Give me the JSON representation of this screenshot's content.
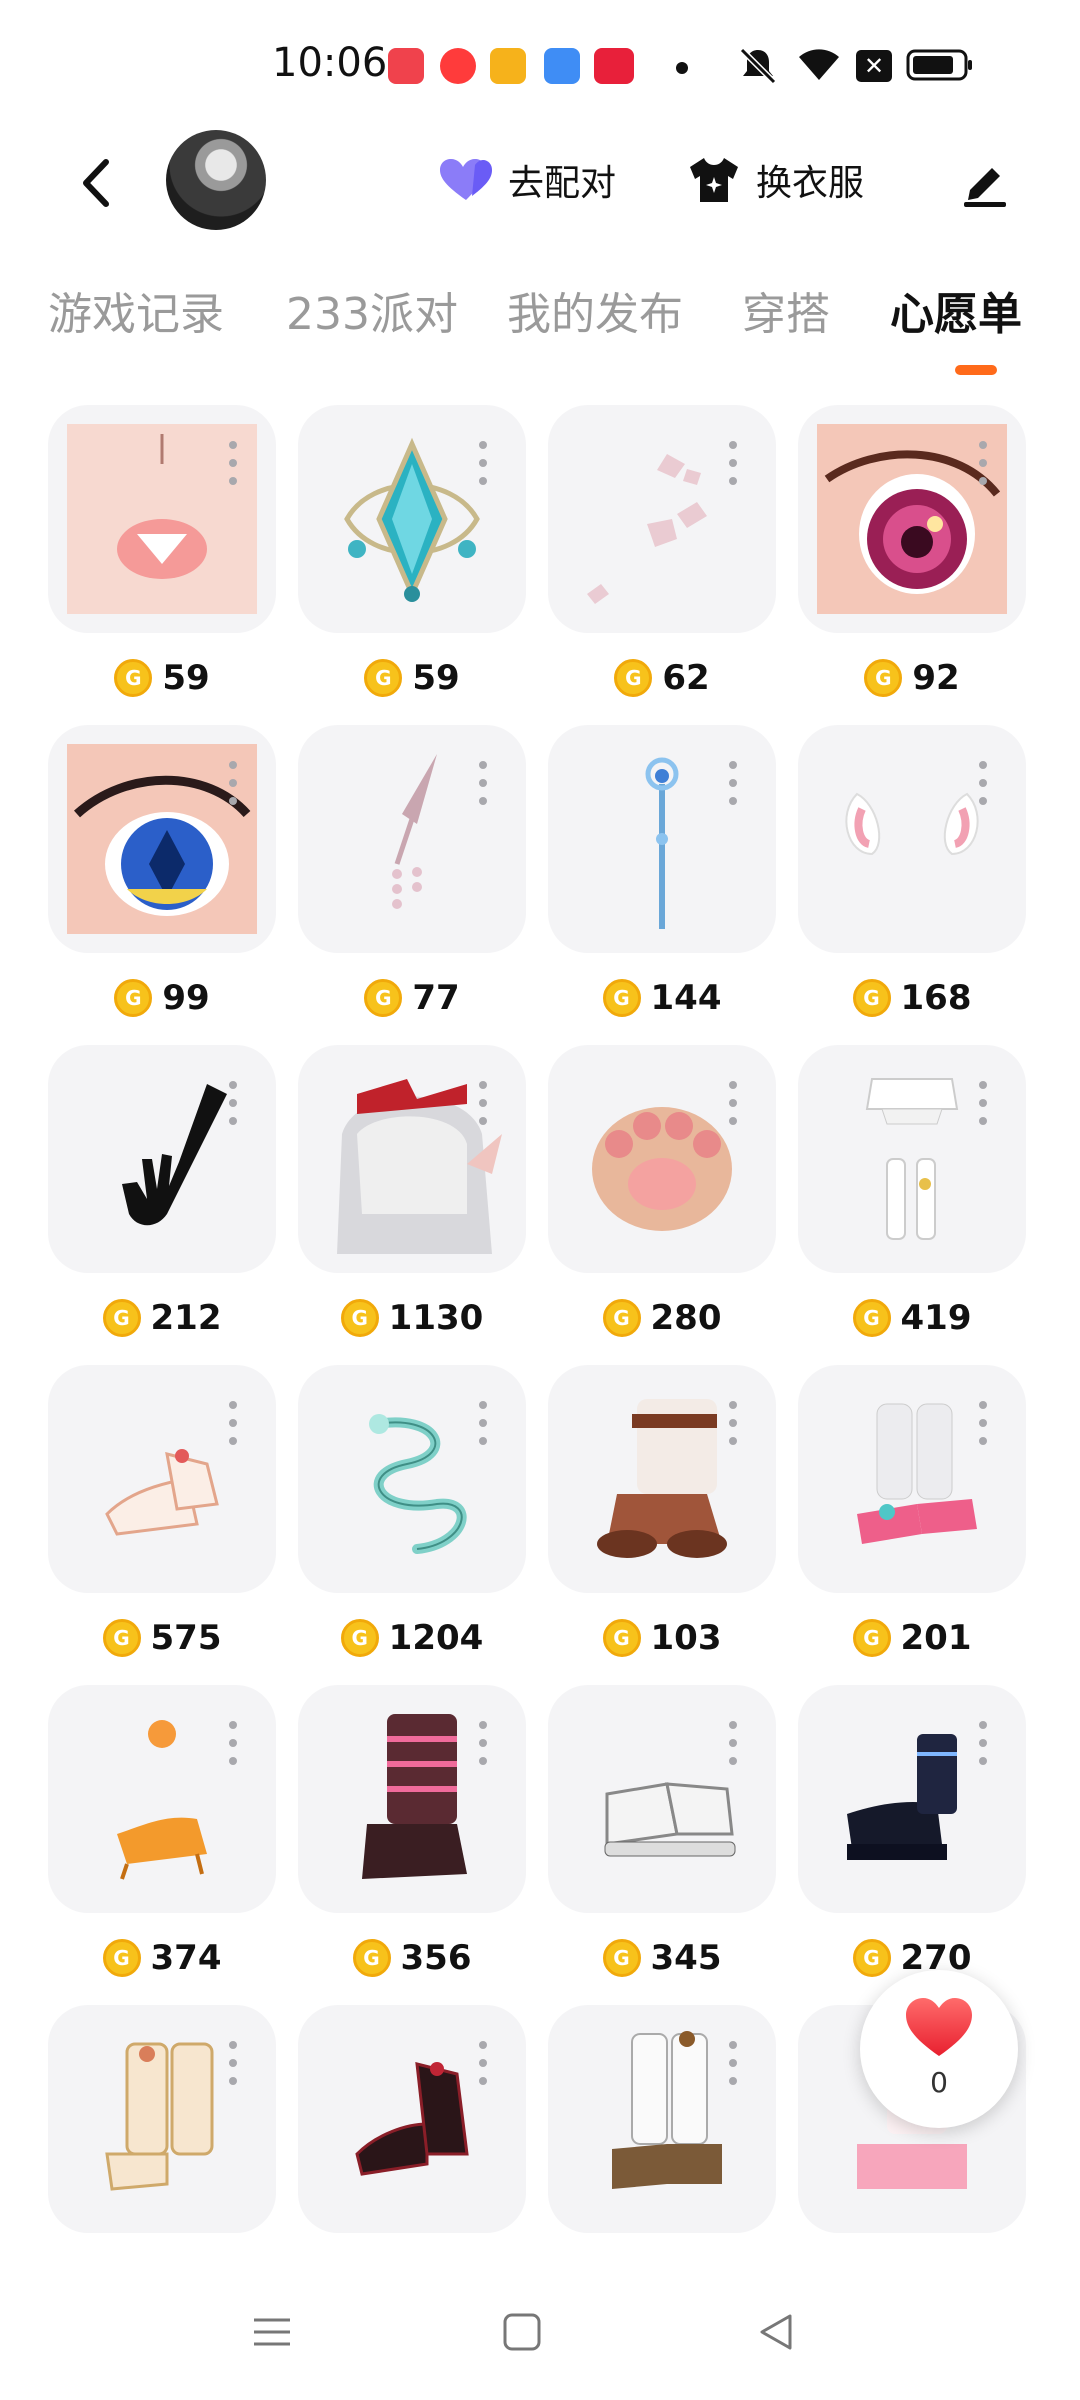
{
  "status_bar": {
    "time": "10:06",
    "icons": [
      "music-app-icon",
      "video-app-icon",
      "tv-app-icon",
      "feather-app-icon",
      "xiaohongshu-app-icon",
      "notification-dot",
      "mute-icon",
      "wifi-icon",
      "close-box-icon",
      "battery-icon"
    ],
    "app_colors": [
      "#f0424c",
      "#ff3b3b",
      "#f6b21b",
      "#3f8df5",
      "#e8203a"
    ]
  },
  "header": {
    "back_icon": "chevron-left-icon",
    "pair_button": {
      "label": "去配对",
      "icon": "hearts-icon",
      "color": "#6a5cf6"
    },
    "outfit_button": {
      "label": "换衣服",
      "icon": "shirt-icon"
    },
    "edit_icon": "pen-icon"
  },
  "tabs": [
    {
      "label": "游戏记录",
      "active": false
    },
    {
      "label": "233派对",
      "active": false
    },
    {
      "label": "我的发布",
      "active": false
    },
    {
      "label": "穿搭",
      "active": false
    },
    {
      "label": "心愿单",
      "active": true
    }
  ],
  "accent_color": "#ff6a1a",
  "coin_symbol": "G",
  "wishlist": {
    "items": [
      {
        "price": "59",
        "art": "mouth"
      },
      {
        "price": "59",
        "art": "gem"
      },
      {
        "price": "62",
        "art": "petals"
      },
      {
        "price": "92",
        "art": "eye-pink"
      },
      {
        "price": "99",
        "art": "eye-blue"
      },
      {
        "price": "77",
        "art": "hairpin"
      },
      {
        "price": "144",
        "art": "wand"
      },
      {
        "price": "168",
        "art": "bunny-ears"
      },
      {
        "price": "212",
        "art": "glove"
      },
      {
        "price": "1130",
        "art": "hair"
      },
      {
        "price": "280",
        "art": "paw"
      },
      {
        "price": "419",
        "art": "stockings"
      },
      {
        "price": "575",
        "art": "heels"
      },
      {
        "price": "1204",
        "art": "dragon"
      },
      {
        "price": "103",
        "art": "fur-boots"
      },
      {
        "price": "201",
        "art": "sock-sandals"
      },
      {
        "price": "374",
        "art": "orange-heels"
      },
      {
        "price": "356",
        "art": "pink-boots"
      },
      {
        "price": "345",
        "art": "sneakers"
      },
      {
        "price": "270",
        "art": "black-platforms"
      },
      {
        "price": "",
        "art": "cream-boots"
      },
      {
        "price": "",
        "art": "black-red-heels"
      },
      {
        "price": "",
        "art": "white-boots"
      },
      {
        "price": "",
        "art": "pink-shoes"
      }
    ]
  },
  "like_fab": {
    "count": "0",
    "icon": "heart-icon"
  },
  "nav_bar": [
    "menu-icon",
    "home-square-icon",
    "back-triangle-icon"
  ]
}
